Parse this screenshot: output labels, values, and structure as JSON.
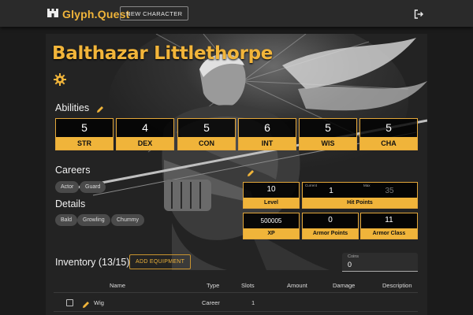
{
  "app": {
    "brand": "Glyph.Quest",
    "new_character_label": "NEW CHARACTER",
    "logo_icon": "castle-icon",
    "logout_icon": "logout-icon"
  },
  "character": {
    "name": "Balthazar Littlethorpe",
    "settings_icon": "gear-icon"
  },
  "abilities": {
    "title": "Abilities",
    "stats": [
      {
        "label": "STR",
        "value": "5"
      },
      {
        "label": "DEX",
        "value": "4"
      },
      {
        "label": "CON",
        "value": "5"
      },
      {
        "label": "INT",
        "value": "6"
      },
      {
        "label": "WIS",
        "value": "5"
      },
      {
        "label": "CHA",
        "value": "5"
      }
    ]
  },
  "careers": {
    "title": "Careers",
    "chips": [
      "Actor",
      "Guard"
    ]
  },
  "details": {
    "title": "Details",
    "chips": [
      "Bald",
      "Growling",
      "Chummy"
    ]
  },
  "vitals": {
    "level": {
      "label": "Level",
      "value": "10"
    },
    "hit_points": {
      "label": "Hit Points",
      "current_label": "Current",
      "current": "1",
      "max_label": "Max",
      "max": "35"
    },
    "xp": {
      "label": "XP",
      "value": "500005"
    },
    "armor_points": {
      "label": "Armor Points",
      "value": "0"
    },
    "armor_class": {
      "label": "Armor Class",
      "value": "11"
    }
  },
  "inventory": {
    "title": "Inventory (13/15)",
    "add_label": "ADD EQUIPMENT",
    "coins_label": "Coins",
    "coins_value": "0",
    "columns": [
      "Name",
      "Type",
      "Slots",
      "Amount",
      "Damage",
      "Description"
    ],
    "rows": [
      {
        "name": "Wig",
        "type": "Career",
        "slots": "1",
        "amount": "",
        "damage": "",
        "description": ""
      }
    ]
  },
  "colors": {
    "accent": "#f0b43a",
    "background": "#1b1b1b",
    "panel": "#232323"
  }
}
